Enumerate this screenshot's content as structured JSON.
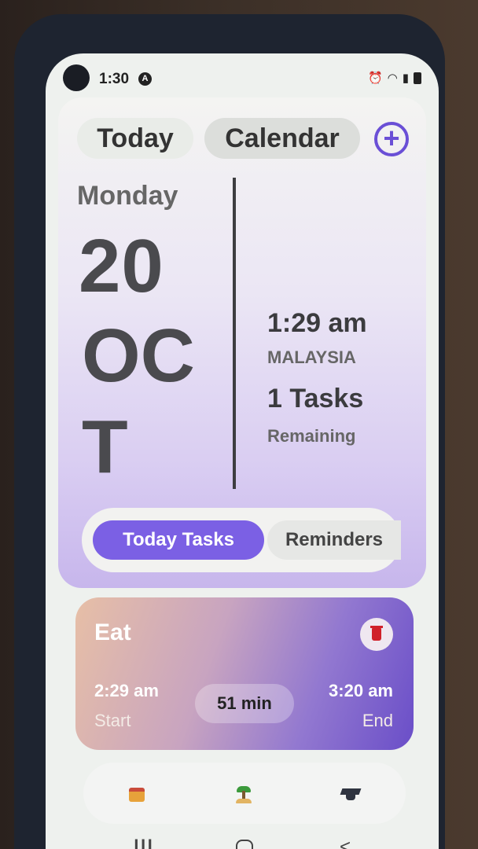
{
  "status_bar": {
    "time": "1:30",
    "badge": "A"
  },
  "header": {
    "tabs": {
      "today": "Today",
      "calendar": "Calendar"
    },
    "add_icon": "plus-circle-icon",
    "date": {
      "weekday": "Monday",
      "day": "20",
      "month_line1": "OC",
      "month_line2": "T"
    },
    "info": {
      "time": "1:29 am",
      "country": "MALAYSIA",
      "tasks": "1 Tasks",
      "remaining": "Remaining"
    }
  },
  "segment": {
    "today_tasks": "Today Tasks",
    "reminders": "Reminders"
  },
  "task": {
    "title": "Eat",
    "start_time": "2:29 am",
    "start_label": "Start",
    "duration": "51 min",
    "end_time": "3:20 am",
    "end_label": "End"
  },
  "bottom_nav": [
    "calendar-icon",
    "island-icon",
    "graduation-cap-icon"
  ],
  "colors": {
    "accent": "#7b60e4",
    "delete": "#d0202a"
  }
}
